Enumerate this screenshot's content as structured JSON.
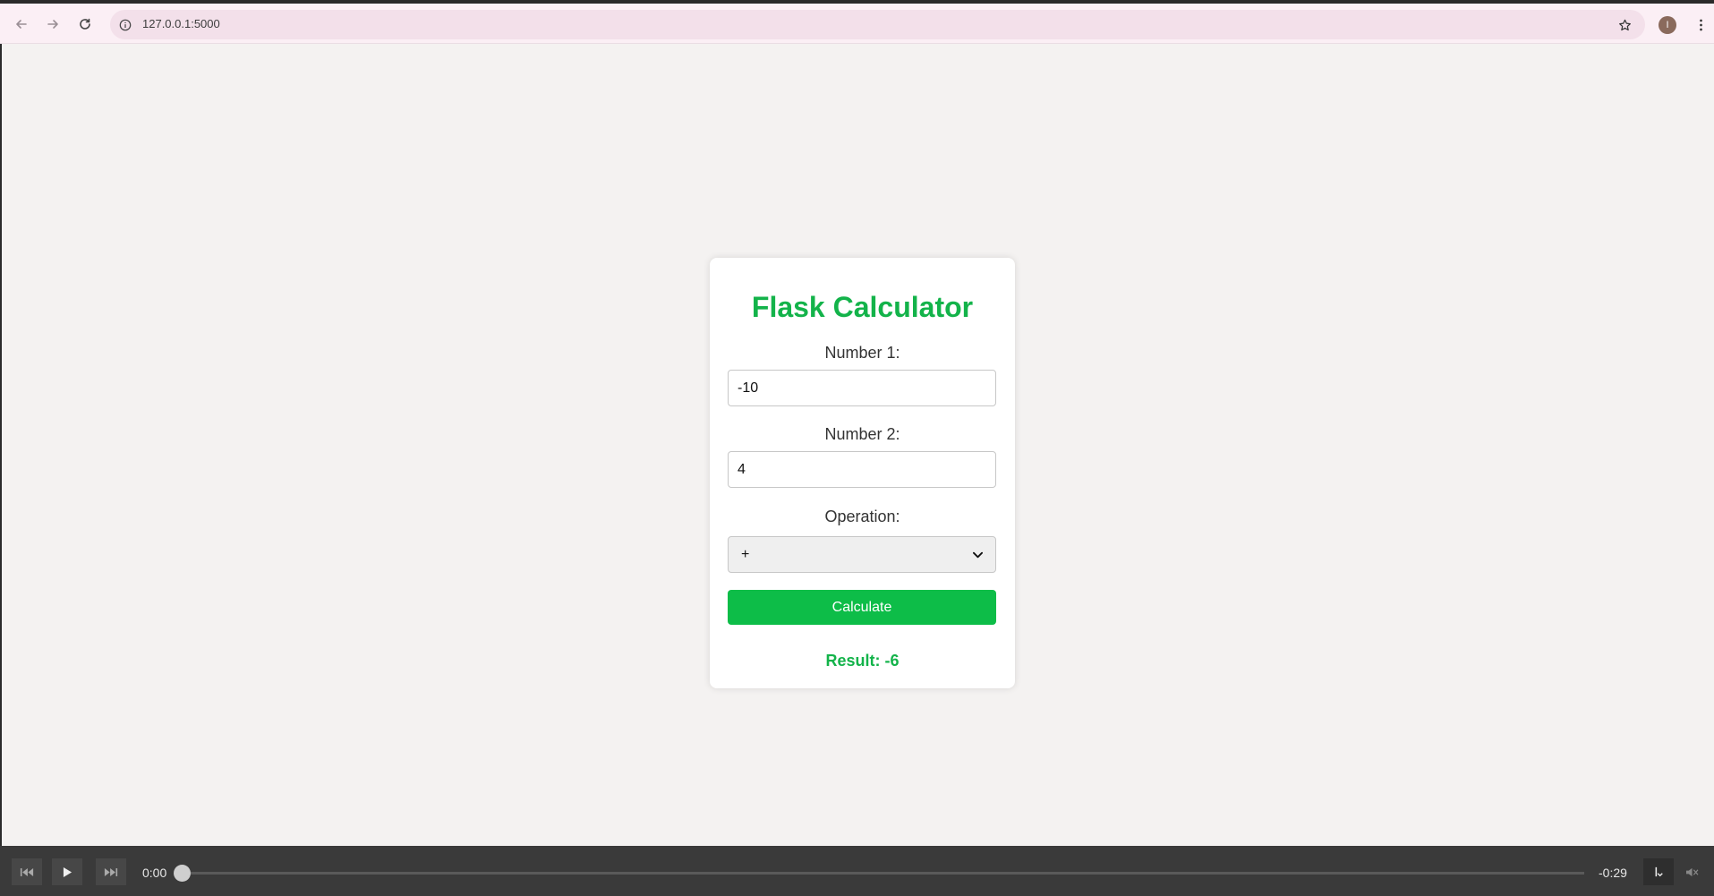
{
  "browser": {
    "url": "127.0.0.1:5000",
    "profile_initial": "I"
  },
  "calculator": {
    "title": "Flask Calculator",
    "number1_label": "Number 1:",
    "number1_value": "-10",
    "number2_label": "Number 2:",
    "number2_value": "4",
    "operation_label": "Operation:",
    "operation_selected": "+",
    "calculate_label": "Calculate",
    "result_text": "Result: -6",
    "accent_color": "#13b34a",
    "button_color": "#0dbd48"
  },
  "media": {
    "current_time": "0:00",
    "remaining_time": "-0:29",
    "progress": 0
  }
}
